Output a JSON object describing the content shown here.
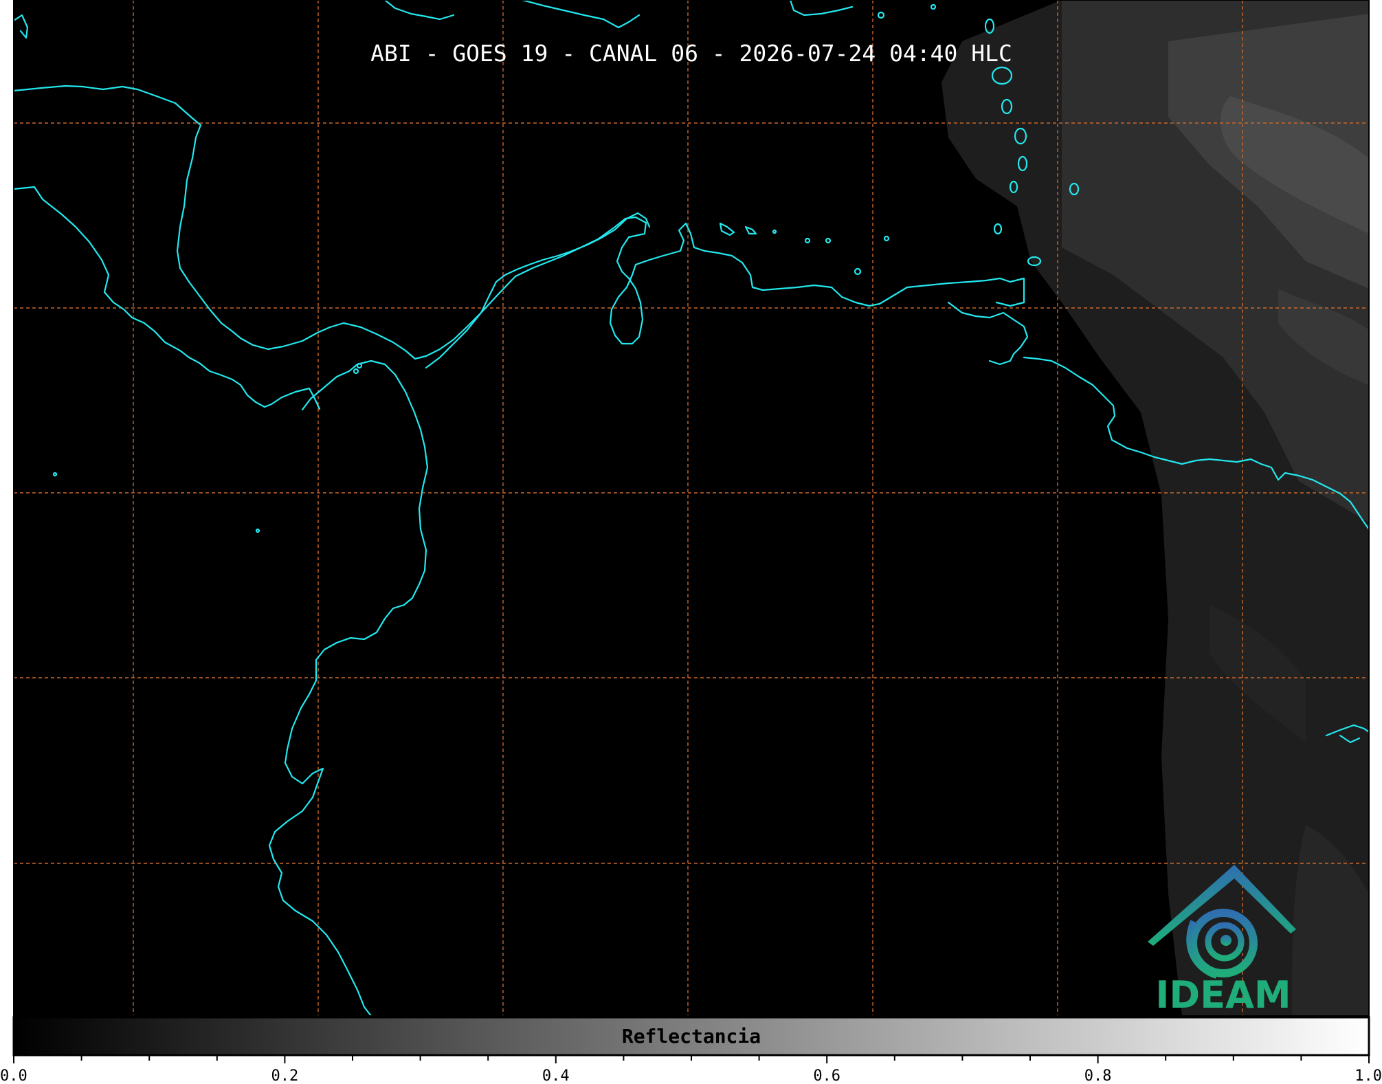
{
  "title": "ABI - GOES 19 - CANAL 06 - 2026-07-24 04:40 HLC",
  "map": {
    "background_color": "#000000",
    "coastline_color": "#22e8ee",
    "gridline_color": "#c8682a",
    "gridline_style": "dashed"
  },
  "colorbar": {
    "label": "Reflectancia",
    "range": [
      0.0,
      1.0
    ],
    "ticks": [
      "0.0",
      "0.2",
      "0.4",
      "0.6",
      "0.8",
      "1.0"
    ],
    "colormap_start": "#000000",
    "colormap_end": "#ffffff"
  },
  "logo": {
    "text": "IDEAM",
    "icon": "ideam-logo-icon",
    "color_top": "#2f6fb0",
    "color_bottom": "#1fae7a"
  }
}
